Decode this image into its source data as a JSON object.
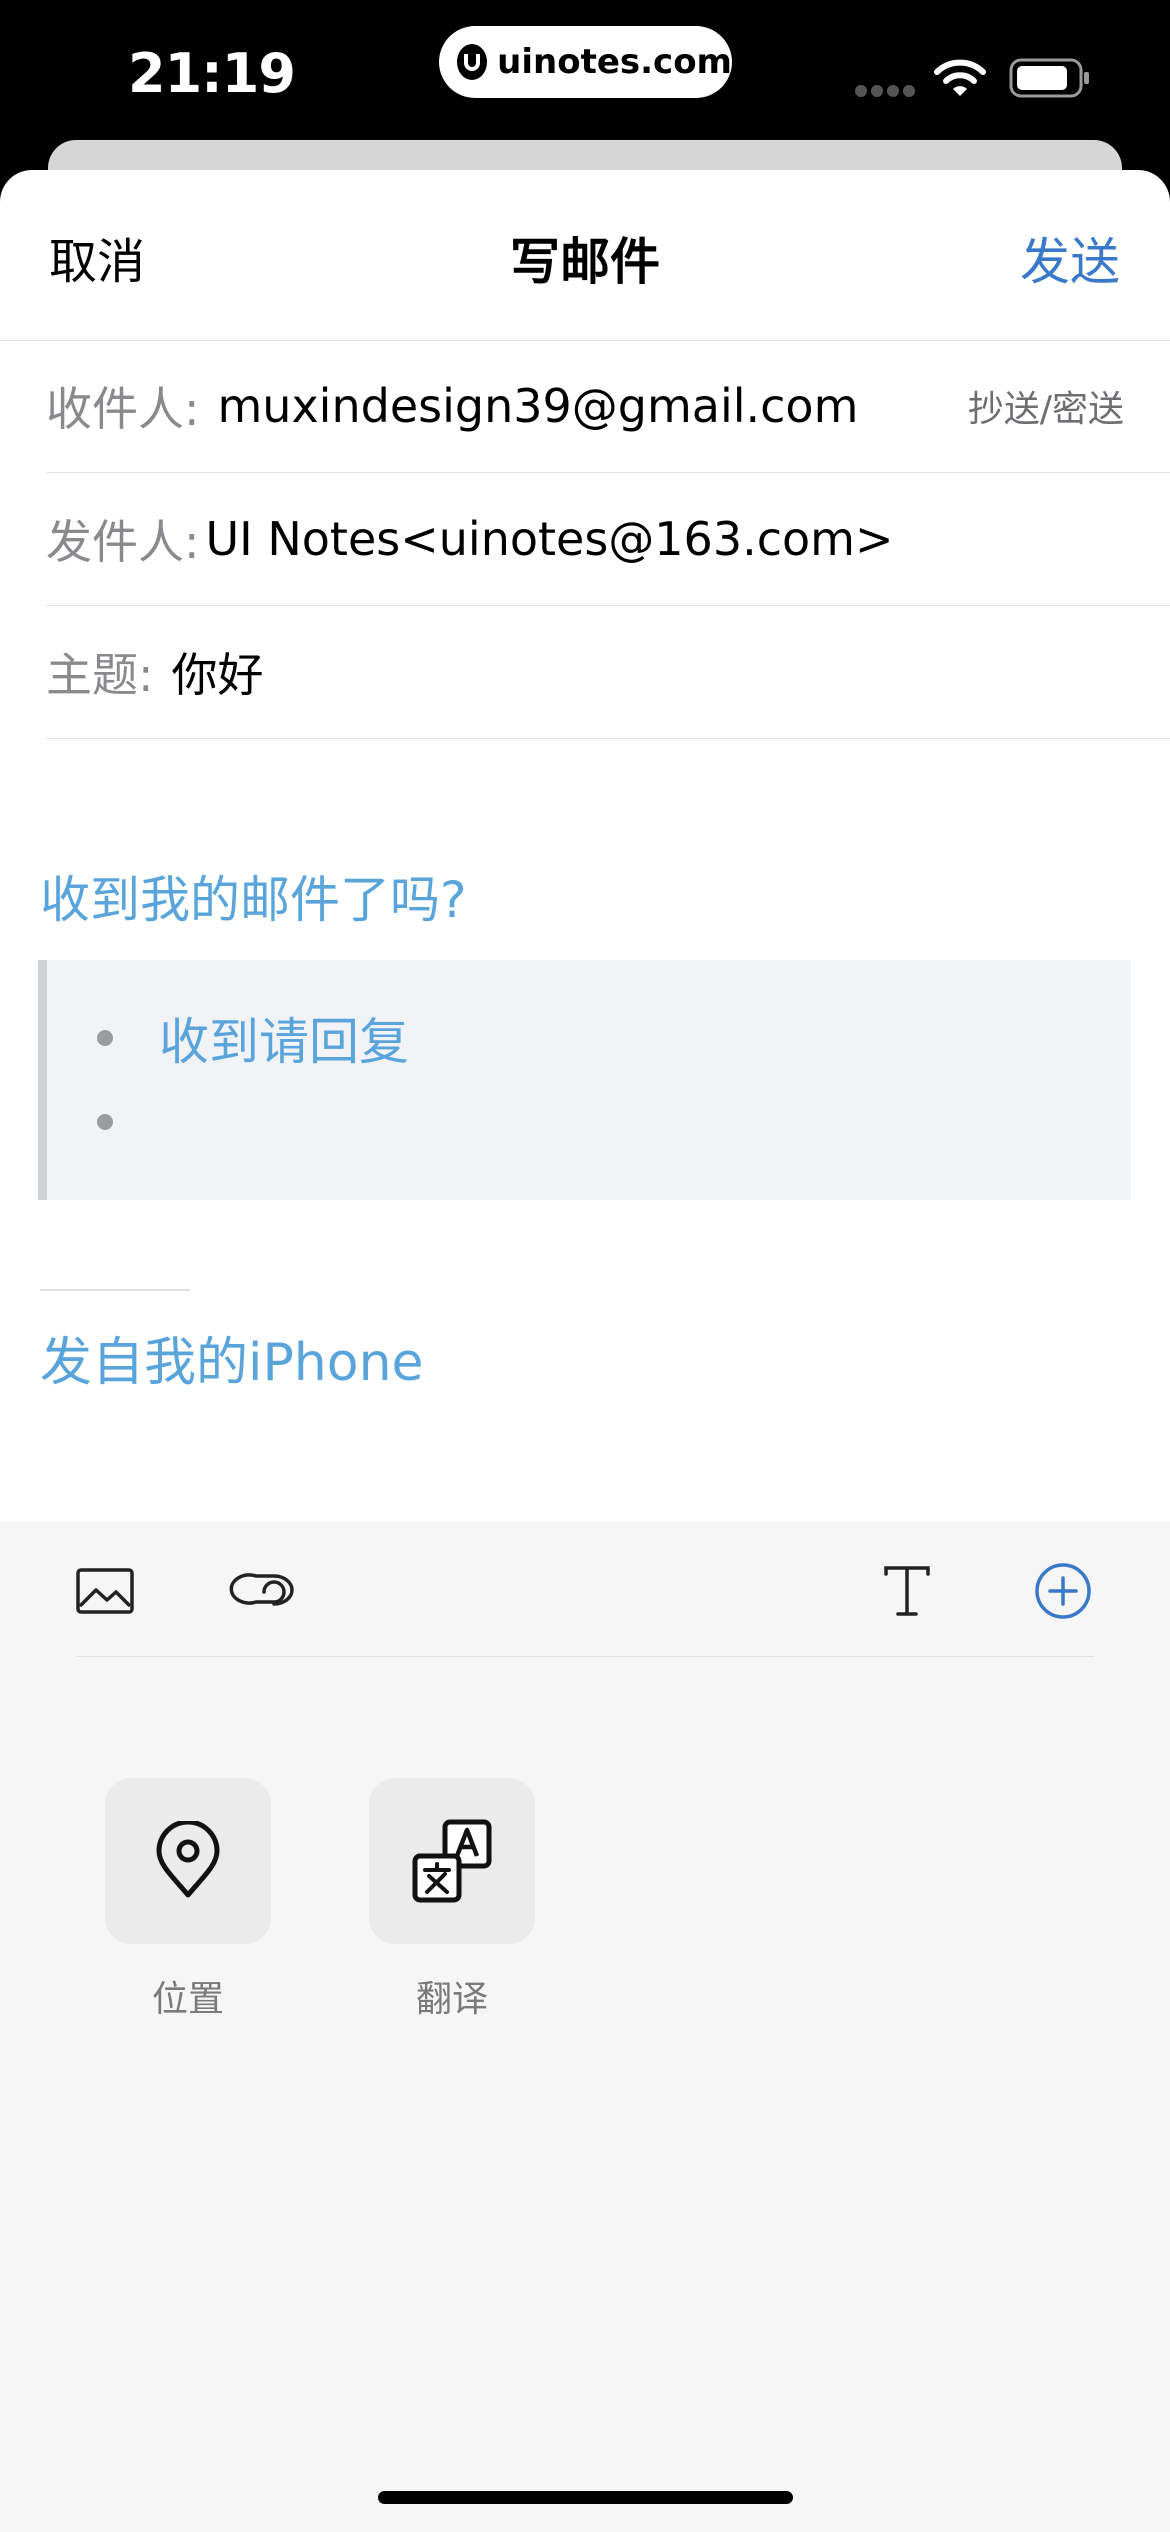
{
  "status_bar": {
    "time": "21:19",
    "url": "uinotes.com"
  },
  "nav": {
    "cancel": "取消",
    "title": "写邮件",
    "send": "发送"
  },
  "fields": {
    "to_label": "收件人:",
    "to_value": "muxindesign39@gmail.com",
    "cc_bcc": "抄送/密送",
    "from_label": "发件人:",
    "from_value": "UI Notes<uinotes@163.com>",
    "subject_label": "主题:",
    "subject_value": "你好"
  },
  "body": {
    "question": "收到我的邮件了吗?",
    "bullets": [
      "收到请回复",
      ""
    ],
    "signature": "发自我的iPhone"
  },
  "toolbar": {
    "icons": [
      "photo-icon",
      "link-icon",
      "text-format-icon",
      "add-circle-icon"
    ],
    "accent": "#3a78c9"
  },
  "apps": [
    {
      "label": "位置",
      "icon": "location-pin-icon"
    },
    {
      "label": "翻译",
      "icon": "translate-icon"
    }
  ]
}
